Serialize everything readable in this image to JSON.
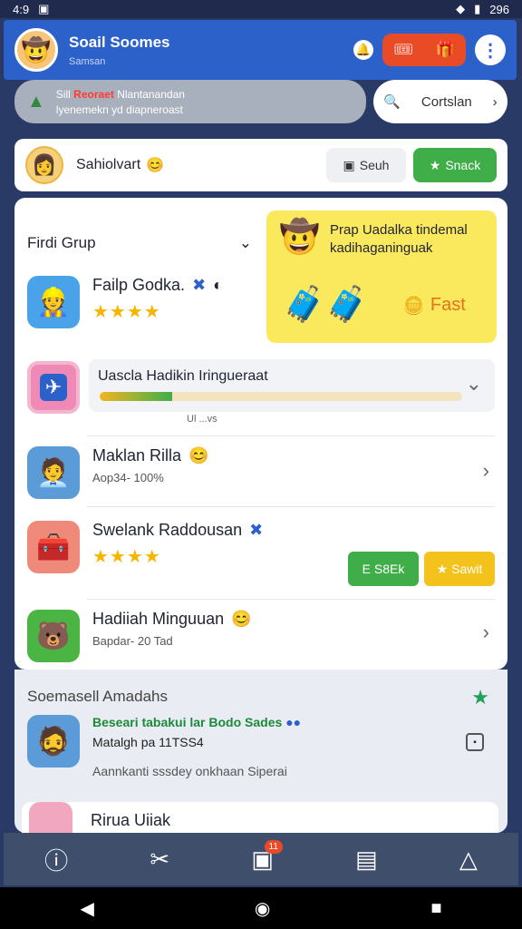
{
  "status": {
    "time": "4:9",
    "right": "296"
  },
  "appbar": {
    "title": "Soail Soomes",
    "subtitle": "Samsan",
    "notif": "1"
  },
  "banner": {
    "line1_a": "Sill",
    "line1_red": "Reoraet",
    "line1_b": "Nlantanandan",
    "line2": "lyenemekn yd diapneroast",
    "contact": "Cortslan"
  },
  "user": {
    "name": "Sahiolvart",
    "btn1": "Seuh",
    "btn2": "Snack"
  },
  "group": {
    "title": "Firdi Grup"
  },
  "promo": {
    "text": "Prap Uadalka tindemal kadihaganinguak",
    "fast": "Fast"
  },
  "apps": [
    {
      "name": "Failp Godka.",
      "rating": "★★★★"
    },
    {
      "name": "Uascla Hadikin Iringueraat",
      "caption": "Ul ...vs"
    },
    {
      "name": "Maklan Rilla",
      "sub": "Aop34- 100%"
    },
    {
      "name": "Swelank Raddousan",
      "rating": "★★★★",
      "btnA": "E S8Ek",
      "btnB": "Sawit"
    },
    {
      "name": "Hadiiah Minguuan",
      "sub": "Bapdar- 20 Tad"
    }
  ],
  "progress": {
    "value": 0.2
  },
  "section": {
    "title": "Soemasell Amadahs",
    "headline": "Beseari tabakui lar Bodo Sades",
    "meta": "Matalgh pa 11TSS4",
    "note": "Aannkanti sssdey onkhaan Siperai"
  },
  "peek": {
    "title": "Rirua Uiiak"
  },
  "nav": {
    "badge": "11"
  }
}
